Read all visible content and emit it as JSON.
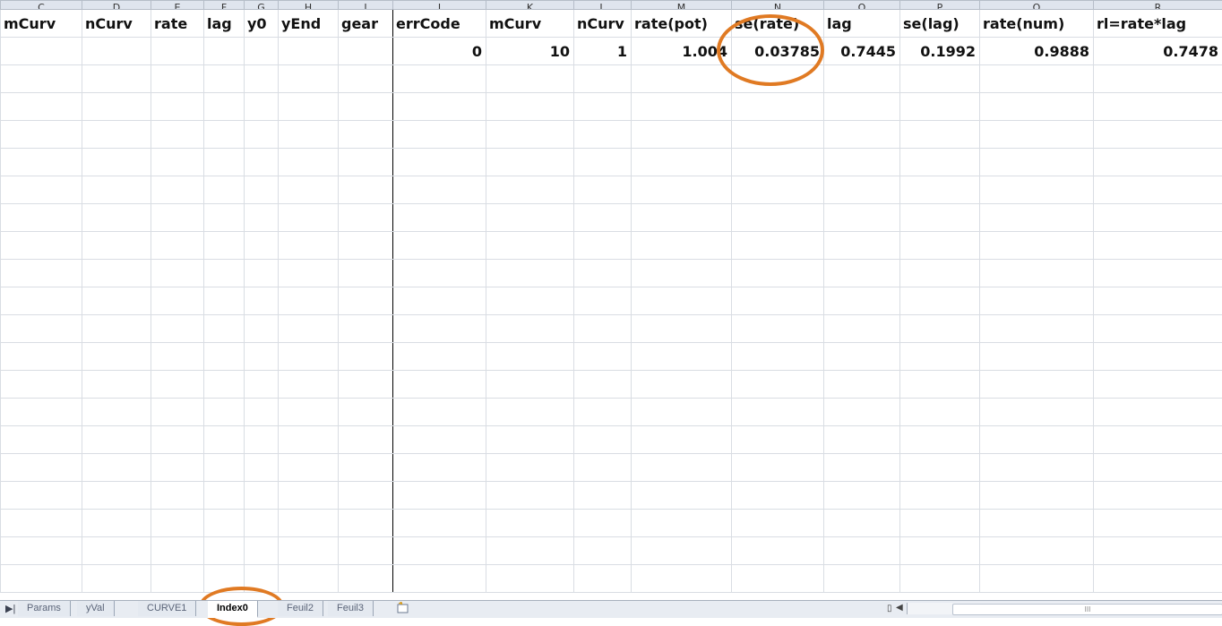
{
  "columns": [
    "C",
    "D",
    "E",
    "F",
    "G",
    "H",
    "I",
    "J",
    "K",
    "L",
    "M",
    "N",
    "O",
    "P",
    "Q",
    "R"
  ],
  "header_row": [
    "mCurv",
    "nCurv",
    "rate",
    "lag",
    "y0",
    "yEnd",
    "gear",
    "errCode",
    "mCurv",
    "nCurv",
    "rate(pot)",
    "se(rate)",
    "lag",
    "se(lag)",
    "rate(num)",
    "rl=rate*lag"
  ],
  "data_row": [
    "",
    "",
    "",
    "",
    "",
    "",
    "",
    "0",
    "10",
    "1",
    "1.004",
    "0.03785",
    "0.7445",
    "0.1992",
    "0.9888",
    "0.7478"
  ],
  "empty_rows": 19,
  "tabs": [
    "Params",
    "yVal",
    "CURVE1",
    "Index0",
    "Feuil2",
    "Feuil3"
  ],
  "active_tab": "Index0",
  "accent_color": "#e07a23",
  "scroll_thumb_label": "III",
  "icons": {
    "nav": "sheet-nav-last-icon",
    "insert": "insert-sheet-icon",
    "split": "split-box-icon",
    "scroll_left": "scroll-left-arrow-icon"
  }
}
